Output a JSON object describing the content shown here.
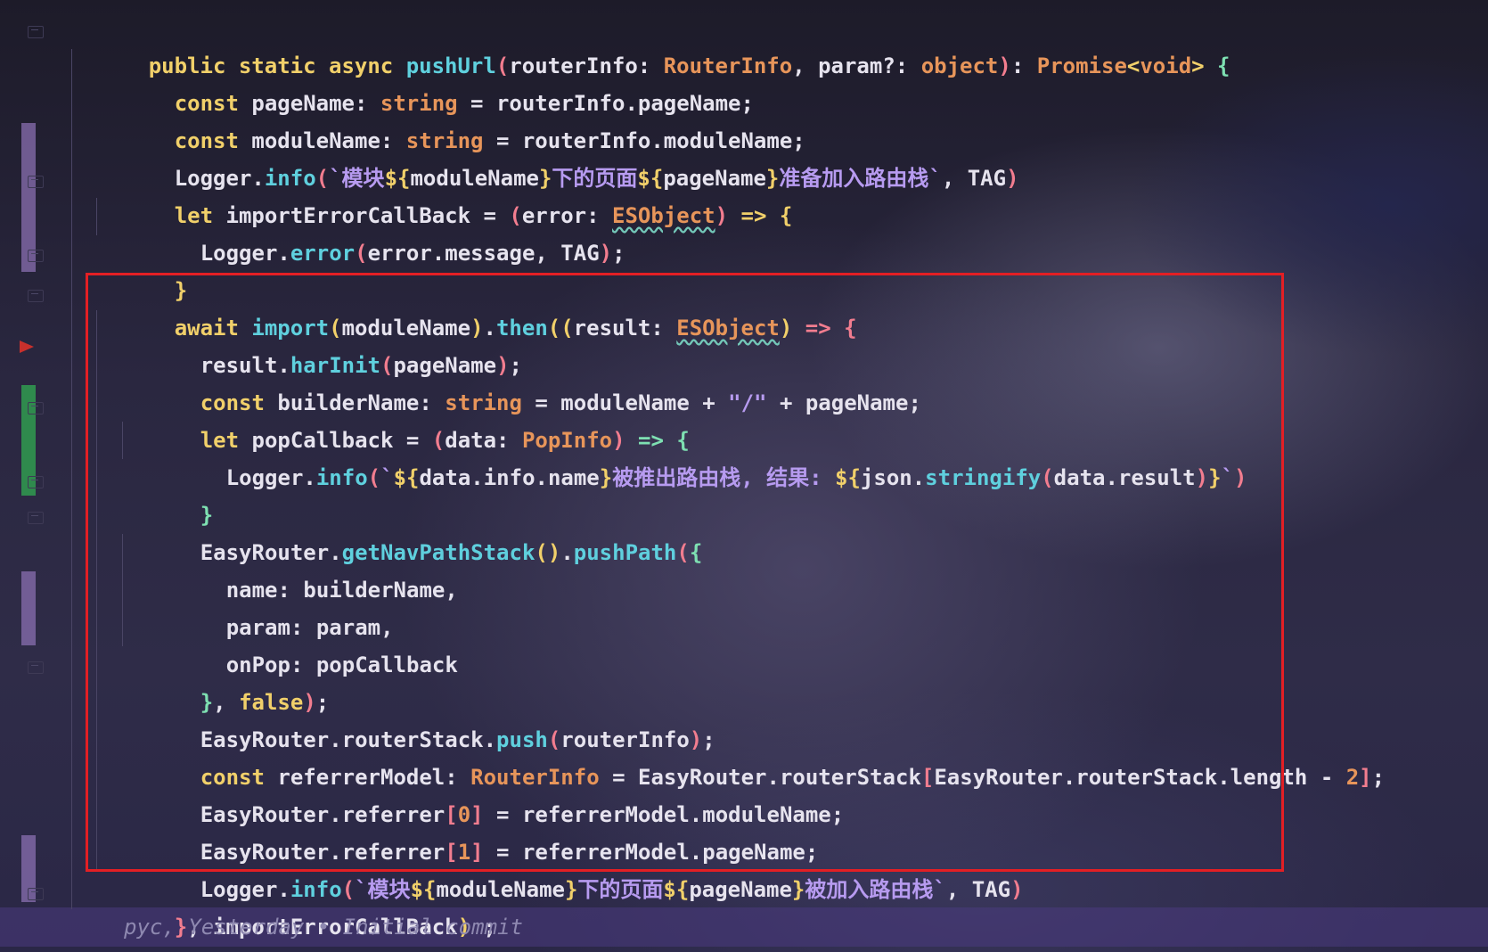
{
  "colors": {
    "keyword": "#f1d06a",
    "type": "#e7955a",
    "function": "#5fd0de",
    "string": "#b79bf0",
    "paren": "#f27d8f",
    "brace": "#7ee0b2",
    "highlight_box": "#e31f24"
  },
  "code": {
    "l1": {
      "a": "public static async ",
      "b": "pushUrl",
      "c": "(",
      "d": "routerInfo: ",
      "e": "RouterInfo",
      "f": ", param?: ",
      "g": "object",
      "h": ")",
      "i": ": ",
      "j": "Promise",
      "k": "<",
      "l": "void",
      "m": ">",
      "n": " {"
    },
    "l2": {
      "a": "const ",
      "b": "pageName: ",
      "c": "string",
      "d": " = routerInfo.pageName;"
    },
    "l3": {
      "a": "const ",
      "b": "moduleName: ",
      "c": "string",
      "d": " = routerInfo.moduleName;"
    },
    "l4": {
      "a": "Logger.",
      "b": "info",
      "c": "(",
      "d": "`模块",
      "e": "${",
      "f": "moduleName",
      "g": "}",
      "h": "下的页面",
      "i": "${",
      "j": "pageName",
      "k": "}",
      "l": "准备加入路由栈`",
      "m": ", TAG",
      "n": ")"
    },
    "l5": {
      "a": "let ",
      "b": "importErrorCallBack = ",
      "c": "(",
      "d": "error: ",
      "e": "ESObject",
      "f": ")",
      "g": " => {"
    },
    "l6": {
      "a": "Logger.",
      "b": "error",
      "c": "(",
      "d": "error.message, TAG",
      "e": ")",
      "f": ";"
    },
    "l7": {
      "a": "}"
    },
    "l8": {
      "a": "await ",
      "b": "import",
      "c": "(",
      "d": "moduleName",
      "e": ")",
      "f": ".",
      "g": "then",
      "h": "((",
      "i": "result: ",
      "j": "ESObject",
      "k": ")",
      "l": " => {"
    },
    "l9": {
      "a": "result.",
      "b": "harInit",
      "c": "(",
      "d": "pageName",
      "e": ")",
      "f": ";"
    },
    "l10": {
      "a": "const ",
      "b": "builderName: ",
      "c": "string",
      "d": " = moduleName + ",
      "e": "\"/\"",
      "f": " + pageName;"
    },
    "l11": {
      "a": "let ",
      "b": "popCallback = ",
      "c": "(",
      "d": "data: ",
      "e": "PopInfo",
      "f": ")",
      "g": " => {"
    },
    "l12": {
      "a": "Logger.",
      "b": "info",
      "c": "(",
      "d": "`",
      "e": "${",
      "f": "data.info.name",
      "g": "}",
      "h": "被推出路由栈, 结果: ",
      "i": "${",
      "j": "json.",
      "k": "stringify",
      "l": "(",
      "m": "data.result",
      "n": ")",
      "o": "}",
      "p": "`",
      "q": ")"
    },
    "l13": {
      "a": "}"
    },
    "l14": {
      "a": "EasyRouter.",
      "b": "getNavPathStack",
      "c": "()",
      "d": ".",
      "e": "pushPath",
      "f": "(",
      "g": "{"
    },
    "l15": {
      "a": "name: builderName,"
    },
    "l16": {
      "a": "param: param,"
    },
    "l17": {
      "a": "onPop: popCallback"
    },
    "l18": {
      "a": "}",
      "b": ", ",
      "c": "false",
      "d": ")",
      "e": ";"
    },
    "l19": {
      "a": "EasyRouter.routerStack.",
      "b": "push",
      "c": "(",
      "d": "routerInfo",
      "e": ")",
      "f": ";"
    },
    "l20": {
      "a": "const ",
      "b": "referrerModel: ",
      "c": "RouterInfo",
      "d": " = EasyRouter.routerStack",
      "e": "[",
      "f": "EasyRouter.routerStack.length - ",
      "g": "2",
      "h": "]",
      "i": ";"
    },
    "l21": {
      "a": "EasyRouter.referrer",
      "b": "[",
      "c": "0",
      "d": "]",
      "e": " = referrerModel.moduleName;"
    },
    "l22": {
      "a": "EasyRouter.referrer",
      "b": "[",
      "c": "1",
      "d": "]",
      "e": " = referrerModel.pageName;"
    },
    "l23": {
      "a": "Logger.",
      "b": "info",
      "c": "(",
      "d": "`模块",
      "e": "${",
      "f": "moduleName",
      "g": "}",
      "h": "下的页面",
      "i": "${",
      "j": "pageName",
      "k": "}",
      "l": "被加入路由栈`",
      "m": ", TAG",
      "n": ")"
    },
    "l24": {
      "a": "}",
      "b": ", importErrorCallBack",
      "c": ")",
      "d": " ;"
    },
    "l25": {
      "a": "}"
    }
  },
  "blame": "pyc, Yesterday • Initial commit"
}
